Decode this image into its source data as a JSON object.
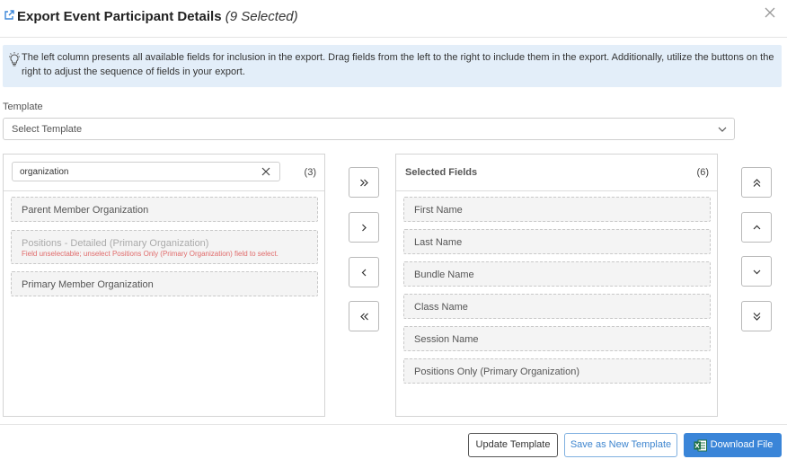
{
  "header": {
    "title": "Export Event Participant Details",
    "selected_count": "(9 Selected)"
  },
  "info": {
    "text": "The left column presents all available fields for inclusion in the export. Drag fields from the left to the right to include them in the export. Additionally, utilize the buttons on the right to adjust the sequence of fields in your export."
  },
  "template": {
    "label": "Template",
    "selected": "Select Template"
  },
  "available": {
    "search_value": "organization",
    "count": "(3)",
    "fields": [
      {
        "label": "Parent Member Organization",
        "disabled": false
      },
      {
        "label": "Positions - Detailed (Primary Organization)",
        "disabled": true,
        "note": "Field unselectable; unselect Positions Only (Primary Organization) field to select."
      },
      {
        "label": "Primary Member Organization",
        "disabled": false
      }
    ]
  },
  "selected": {
    "title": "Selected Fields",
    "count": "(6)",
    "fields": [
      {
        "label": "First Name"
      },
      {
        "label": "Last Name"
      },
      {
        "label": "Bundle Name"
      },
      {
        "label": "Class Name"
      },
      {
        "label": "Session Name"
      },
      {
        "label": "Positions Only (Primary Organization)"
      }
    ]
  },
  "footer": {
    "update_label": "Update Template",
    "save_as_label": "Save as New Template",
    "download_label": "Download File"
  },
  "colors": {
    "primary": "#3a85d8",
    "info_bg": "#e3eef9",
    "error": "#e06b6b"
  }
}
